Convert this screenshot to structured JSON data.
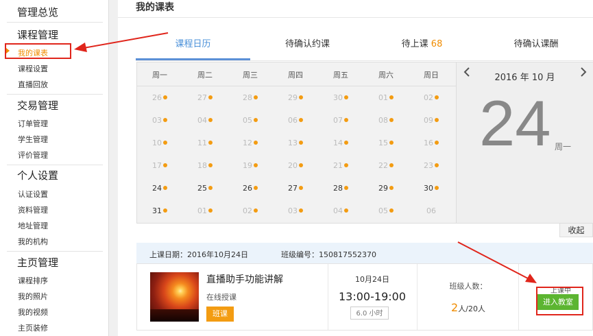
{
  "sidebar": {
    "sections": [
      {
        "title": "管理总览",
        "items": []
      },
      {
        "title": "课程管理",
        "items": [
          "我的课表",
          "课程设置",
          "直播回放"
        ]
      },
      {
        "title": "交易管理",
        "items": [
          "订单管理",
          "学生管理",
          "评价管理"
        ]
      },
      {
        "title": "个人设置",
        "items": [
          "认证设置",
          "资料管理",
          "地址管理",
          "我的机构"
        ]
      },
      {
        "title": "主页管理",
        "items": [
          "课程排序",
          "我的照片",
          "我的视频",
          "主页装修"
        ]
      }
    ],
    "active_item": "我的课表"
  },
  "page_title": "我的课表",
  "tabs": [
    {
      "label": "课程日历"
    },
    {
      "label": "待确认约课"
    },
    {
      "label": "待上课",
      "badge": "68"
    },
    {
      "label": "待确认课酬"
    }
  ],
  "calendar": {
    "weekdays": [
      "周一",
      "周二",
      "周三",
      "周四",
      "周五",
      "周六",
      "周日"
    ],
    "weeks": [
      [
        "26",
        "27",
        "28",
        "29",
        "30",
        "01",
        "02"
      ],
      [
        "03",
        "04",
        "05",
        "06",
        "07",
        "08",
        "09"
      ],
      [
        "10",
        "11",
        "12",
        "13",
        "14",
        "15",
        "16"
      ],
      [
        "17",
        "18",
        "19",
        "20",
        "21",
        "22",
        "23"
      ],
      [
        "24",
        "25",
        "26",
        "27",
        "28",
        "29",
        "30"
      ],
      [
        "31",
        "01",
        "02",
        "03",
        "04",
        "05",
        "06"
      ]
    ],
    "month_label": "2016 年 10 月",
    "big_day": "24",
    "big_weekday": "周一",
    "prev_icon": "chevron-left-icon",
    "next_icon": "chevron-right-icon",
    "collapse_label": "收起"
  },
  "course": {
    "date_label": "上课日期：2016年10月24日",
    "class_no_label": "班级编号：150817552370",
    "title": "直播助手功能讲解",
    "type": "在线授课",
    "tag": "班课",
    "date": "10月24日",
    "time": "13:00-19:00",
    "duration": "6.0 小时",
    "count_label": "班级人数：",
    "count_current": "2",
    "count_total": "人/20人",
    "status": "上课中",
    "enter_label": "进入教室"
  },
  "colors": {
    "accent": "#f08c00",
    "tab_active": "#4a90d9",
    "enter_button": "#5cb531",
    "annotation": "#e0251b"
  }
}
